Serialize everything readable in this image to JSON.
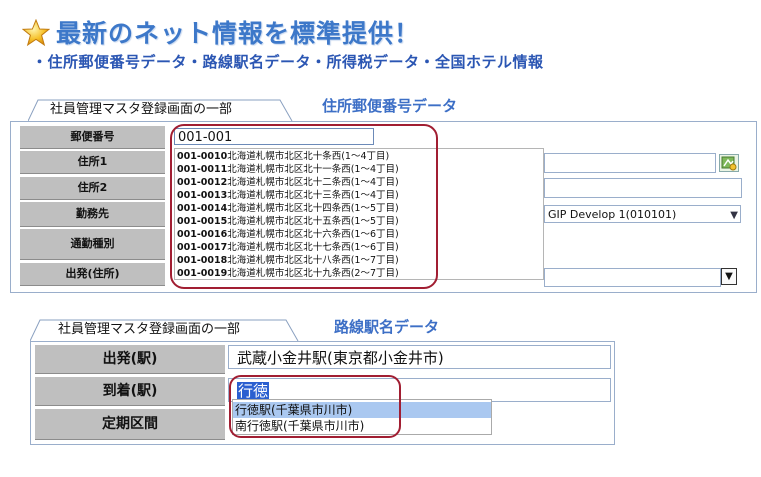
{
  "header": {
    "title": "最新のネット情報を標準提供！",
    "subtitle": "・住所郵便番号データ・路線駅名データ・所得税データ・全国ホテル情報"
  },
  "section1": {
    "tab_label": "社員管理マスタ登録画面の一部",
    "section_label": "住所郵便番号データ",
    "labels": [
      "郵便番号",
      "住所1",
      "住所2",
      "勤務先",
      "通勤種別",
      "出発(住所)"
    ],
    "postal_code_value": "001-001",
    "suggestions": [
      {
        "code": "001-0010",
        "address": "北海道札幌市北区北十条西(1〜4丁目)"
      },
      {
        "code": "001-0011",
        "address": "北海道札幌市北区北十一条西(1〜4丁目)"
      },
      {
        "code": "001-0012",
        "address": "北海道札幌市北区北十二条西(1〜4丁目)"
      },
      {
        "code": "001-0013",
        "address": "北海道札幌市北区北十三条西(1〜4丁目)"
      },
      {
        "code": "001-0014",
        "address": "北海道札幌市北区北十四条西(1〜5丁目)"
      },
      {
        "code": "001-0015",
        "address": "北海道札幌市北区北十五条西(1〜5丁目)"
      },
      {
        "code": "001-0016",
        "address": "北海道札幌市北区北十六条西(1〜6丁目)"
      },
      {
        "code": "001-0017",
        "address": "北海道札幌市北区北十七条西(1〜6丁目)"
      },
      {
        "code": "001-0018",
        "address": "北海道札幌市北区北十八条西(1〜7丁目)"
      },
      {
        "code": "001-0019",
        "address": "北海道札幌市北区北十九条西(2〜7丁目)"
      }
    ],
    "workplace_value": "GIP Develop 1(010101)"
  },
  "section2": {
    "tab_label": "社員管理マスタ登録画面の一部",
    "section_label": "路線駅名データ",
    "labels": [
      "出発(駅)",
      "到着(駅)",
      "定期区間"
    ],
    "departure_value": "武蔵小金井駅(東京都小金井市)",
    "arrival_value": "行徳",
    "suggestions": [
      {
        "text": "行徳駅(千葉県市川市)"
      },
      {
        "text": "南行徳駅(千葉県市川市)"
      }
    ]
  },
  "icons": {
    "star": "star-icon",
    "map": "map-lookup-icon",
    "dropdown": "chevron-down-icon"
  },
  "colors": {
    "title": "#3d78c9",
    "subtitle": "#2b56b3",
    "highlight_border": "#a11e32",
    "label_bg": "#bfbfbf",
    "selection": "#2a5fd0"
  }
}
